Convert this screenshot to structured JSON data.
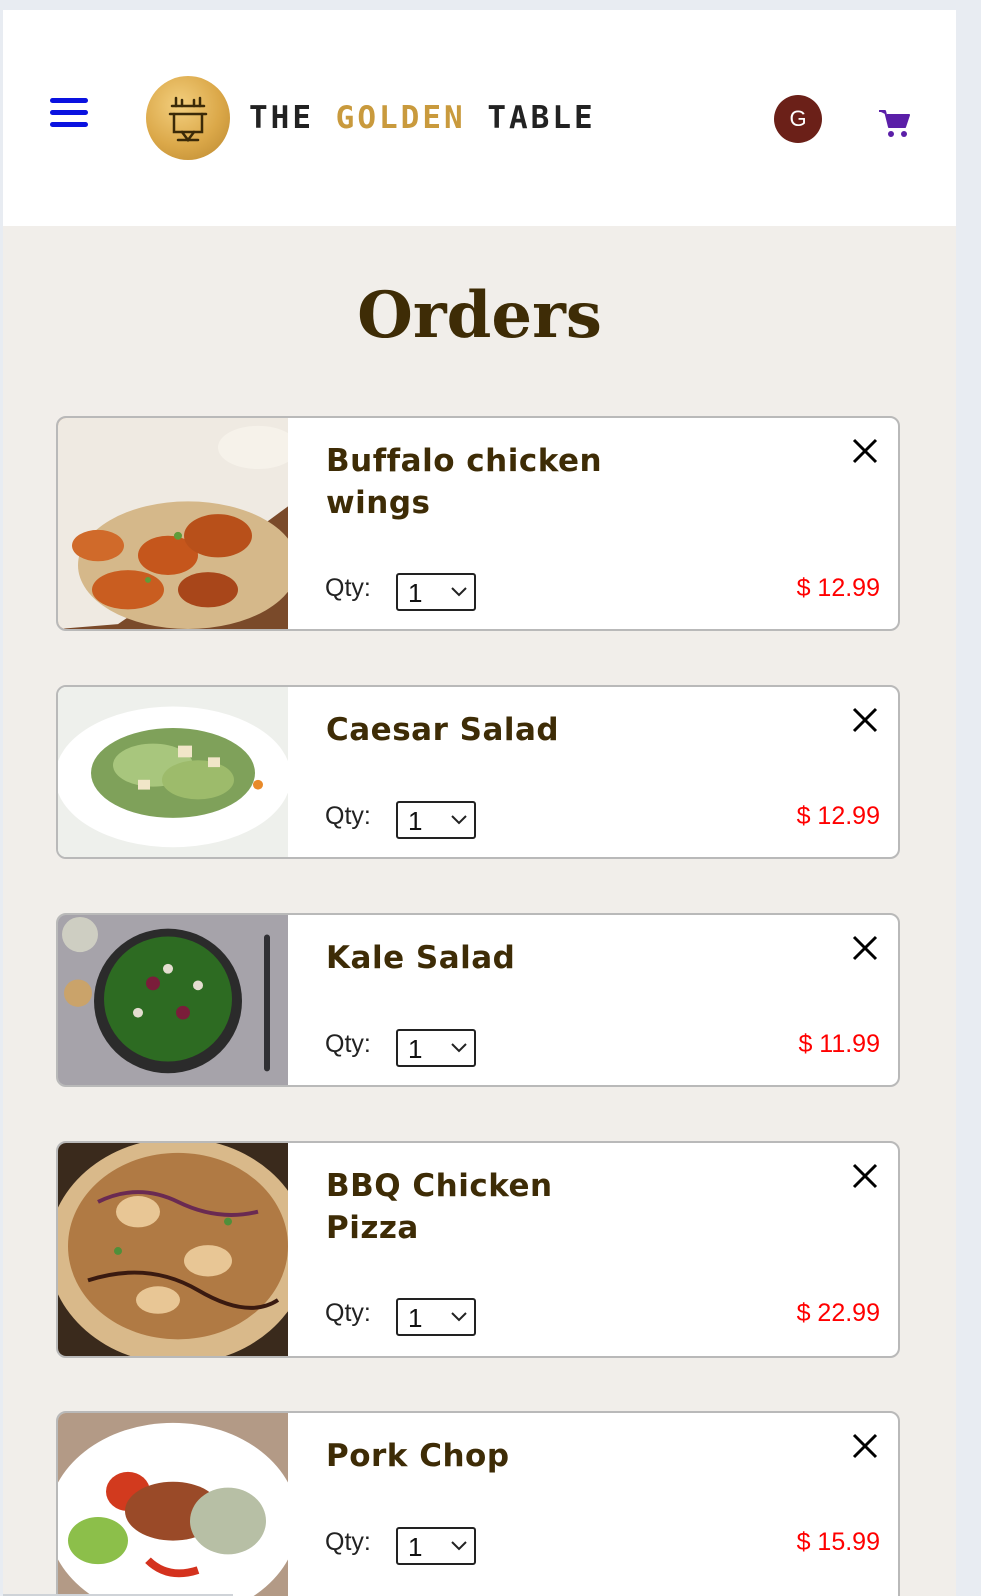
{
  "header": {
    "brand": {
      "the": "THE",
      "golden": "GOLDEN",
      "table": "TABLE"
    },
    "avatar_initial": "G",
    "icons": {
      "menu": "hamburger-icon",
      "cart": "shopping-cart-icon",
      "remove": "close-icon"
    }
  },
  "page": {
    "title": "Orders",
    "qty_label": "Qty:"
  },
  "orders": [
    {
      "name": "Buffalo chicken wings",
      "qty": "1",
      "price": "$ 12.99"
    },
    {
      "name": "Caesar Salad",
      "qty": "1",
      "price": "$ 12.99"
    },
    {
      "name": "Kale Salad",
      "qty": "1",
      "price": "$ 11.99"
    },
    {
      "name": "BBQ Chicken Pizza",
      "qty": "1",
      "price": "$ 22.99"
    },
    {
      "name": "Pork Chop",
      "qty": "1",
      "price": "$ 15.99"
    }
  ],
  "colors": {
    "title": "#3e2c06",
    "price": "#ff0000",
    "menu_icon": "#0a12e0",
    "cart_icon": "#5b1fa8",
    "avatar_bg": "#6b2018",
    "brand_gold": "#c99a3d",
    "page_bg": "#f1eeea"
  }
}
